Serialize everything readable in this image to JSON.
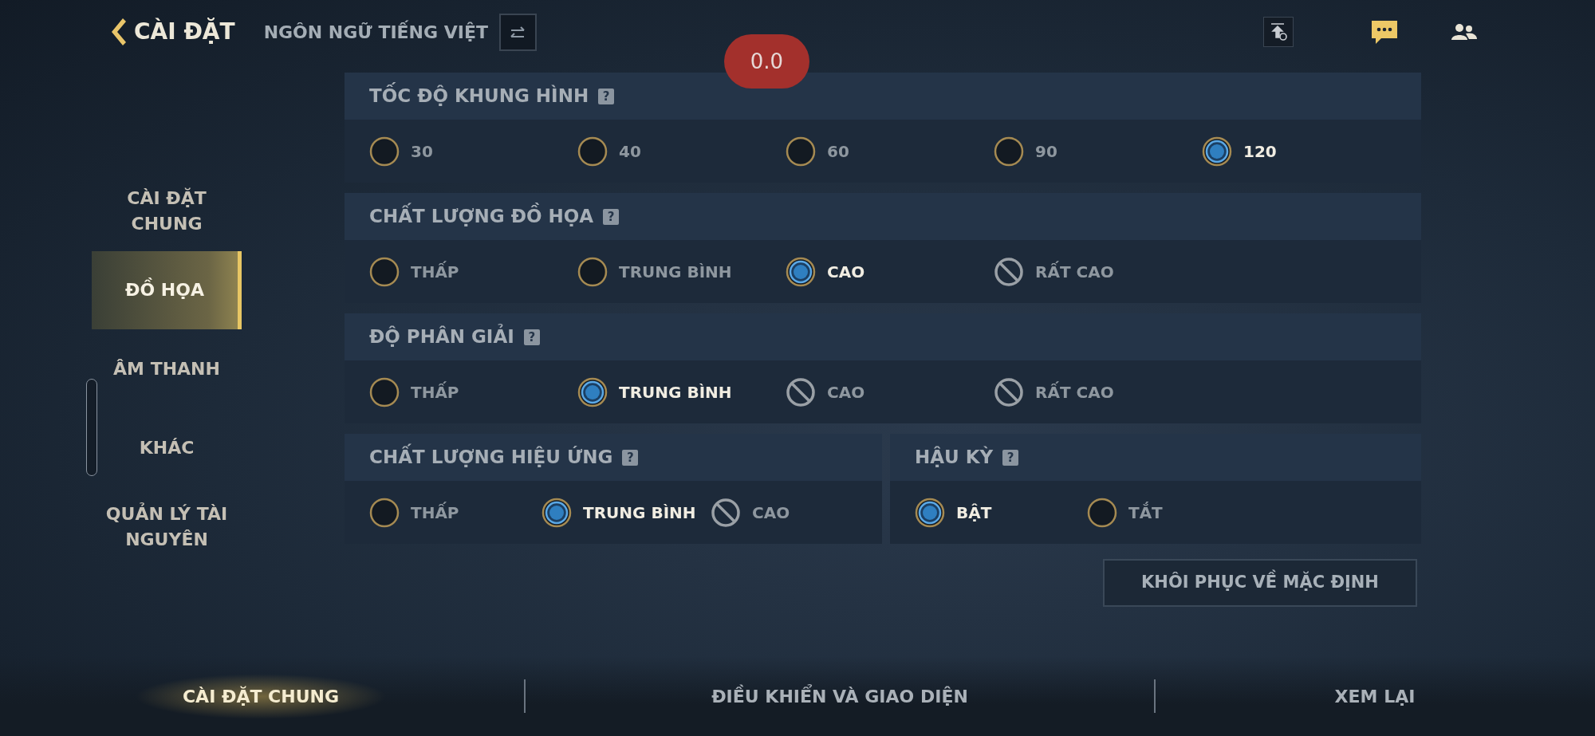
{
  "header": {
    "back_title": "CÀI ĐẶT",
    "language_label": "NGÔN NGỮ TIẾNG VIỆT"
  },
  "overlay_badge": "0.0",
  "sidebar": {
    "items": [
      {
        "label": "CÀI ĐẶT CHUNG",
        "selected": false
      },
      {
        "label": "ĐỒ HỌA",
        "selected": true
      },
      {
        "label": "ÂM THANH",
        "selected": false
      },
      {
        "label": "KHÁC",
        "selected": false
      },
      {
        "label": "QUẢN LÝ TÀI NGUYÊN",
        "selected": false
      }
    ]
  },
  "panel_rows": [
    [
      {
        "title": "TỐC ĐỘ KHUNG HÌNH",
        "help": "?",
        "options": [
          {
            "label": "30",
            "selected": false,
            "disabled": false
          },
          {
            "label": "40",
            "selected": false,
            "disabled": false
          },
          {
            "label": "60",
            "selected": false,
            "disabled": false
          },
          {
            "label": "90",
            "selected": false,
            "disabled": false
          },
          {
            "label": "120",
            "selected": true,
            "disabled": false
          }
        ]
      }
    ],
    [
      {
        "title": "CHẤT LƯỢNG ĐỒ HỌA",
        "help": "?",
        "options": [
          {
            "label": "THẤP",
            "selected": false,
            "disabled": false
          },
          {
            "label": "TRUNG BÌNH",
            "selected": false,
            "disabled": false
          },
          {
            "label": "CAO",
            "selected": true,
            "disabled": false
          },
          {
            "label": "RẤT CAO",
            "selected": false,
            "disabled": true
          }
        ]
      }
    ],
    [
      {
        "title": "ĐỘ PHÂN GIẢI",
        "help": "?",
        "options": [
          {
            "label": "THẤP",
            "selected": false,
            "disabled": false
          },
          {
            "label": "TRUNG BÌNH",
            "selected": true,
            "disabled": false
          },
          {
            "label": "CAO",
            "selected": false,
            "disabled": true
          },
          {
            "label": "RẤT CAO",
            "selected": false,
            "disabled": true
          }
        ]
      }
    ],
    [
      {
        "title": "CHẤT LƯỢNG HIỆU ỨNG",
        "help": "?",
        "options": [
          {
            "label": "THẤP",
            "selected": false,
            "disabled": false
          },
          {
            "label": "TRUNG BÌNH",
            "selected": true,
            "disabled": false
          },
          {
            "label": "CAO",
            "selected": false,
            "disabled": true
          }
        ]
      },
      {
        "title": "HẬU KỲ",
        "help": "?",
        "options": [
          {
            "label": "BẬT",
            "selected": true,
            "disabled": false
          },
          {
            "label": "TẮT",
            "selected": false,
            "disabled": false
          }
        ]
      }
    ]
  ],
  "reset_button": "KHÔI PHỤC VỀ MẶC ĐỊNH",
  "bottom_tabs": [
    {
      "label": "CÀI ĐẶT CHUNG",
      "selected": true
    },
    {
      "label": "ĐIỀU KHIỂN VÀ GIAO DIỆN",
      "selected": false
    },
    {
      "label": "XEM LẠI",
      "selected": false
    }
  ]
}
